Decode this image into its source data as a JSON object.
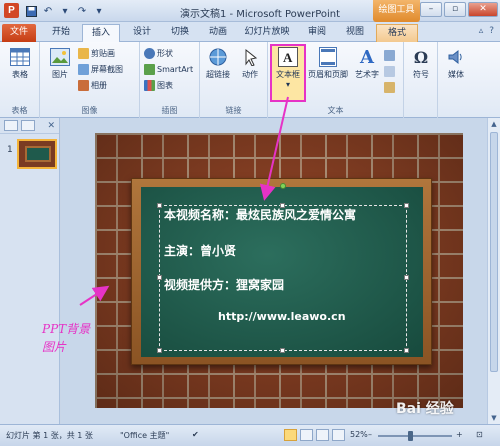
{
  "app": {
    "title": "演示文稿1 - Microsoft PowerPoint",
    "context_title": "绘图工具",
    "window_controls": [
      "–",
      "▫",
      "✕"
    ]
  },
  "tabs": [
    {
      "label": "文件",
      "kind": "file"
    },
    {
      "label": "开始",
      "kind": "normal"
    },
    {
      "label": "插入",
      "kind": "active"
    },
    {
      "label": "设计",
      "kind": "normal"
    },
    {
      "label": "切换",
      "kind": "normal"
    },
    {
      "label": "动画",
      "kind": "normal"
    },
    {
      "label": "幻灯片放映",
      "kind": "normal"
    },
    {
      "label": "审阅",
      "kind": "normal"
    },
    {
      "label": "视图",
      "kind": "normal"
    },
    {
      "label": "格式",
      "kind": "ctx"
    }
  ],
  "ribbon": {
    "groups": {
      "table": "表格",
      "images": "图像",
      "illustrations": "插图",
      "links": "链接",
      "text": "文本"
    },
    "buttons": {
      "table": "表格",
      "picture": "图片",
      "clipart": "剪贴画",
      "screenshot": "屏幕截图",
      "album": "相册",
      "shapes": "形状",
      "smartart": "SmartArt",
      "chart": "图表",
      "hyperlink": "超链接",
      "action": "动作",
      "textbox": "文本框",
      "header_footer": "页眉和页脚",
      "wordart": "艺术字",
      "symbol": "符号",
      "media": "媒体"
    }
  },
  "slide_panel": {
    "slide_number": "1"
  },
  "slide": {
    "line1": "本视频名称：最炫民族风之爱情公寓",
    "line2": "主演：曾小贤",
    "line3": "视频提供方：狸窝家园",
    "url": "http://www.leawo.cn"
  },
  "annotation": {
    "text": "PPT背景图片"
  },
  "statusbar": {
    "slide_info": "幻灯片 第 1 张，共 1 张",
    "theme": "\"Office 主题\"",
    "zoom": "52%"
  },
  "watermark": "Bai 经验"
}
